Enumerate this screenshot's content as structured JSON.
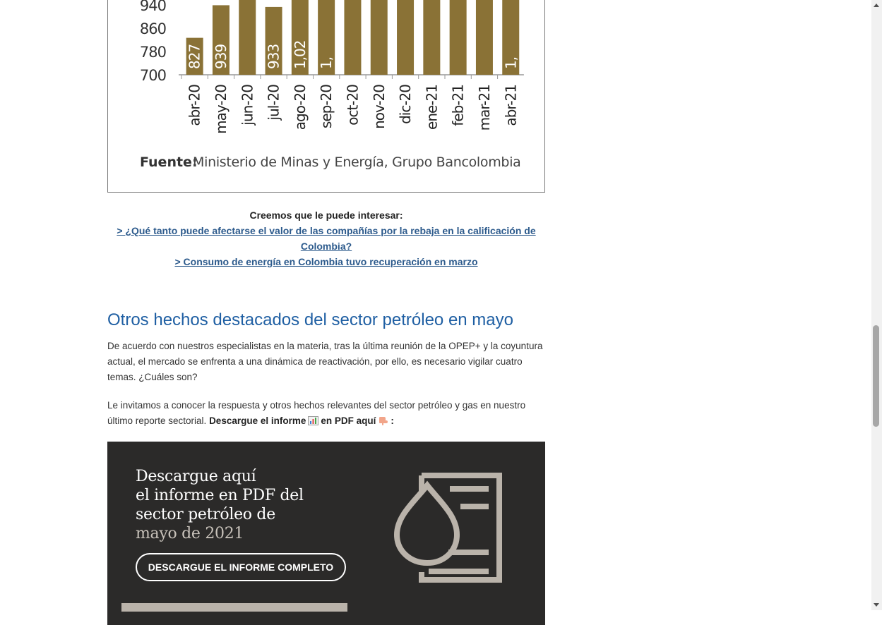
{
  "chart_data": {
    "type": "bar",
    "categories": [
      "abr-20",
      "may-20",
      "jun-20",
      "jul-20",
      "ago-20",
      "sep-20",
      "oct-20",
      "nov-20",
      "dic-20",
      "ene-21",
      "feb-21",
      "mar-21",
      "abr-21"
    ],
    "values": [
      827,
      939,
      null,
      933,
      null,
      null,
      null,
      null,
      null,
      null,
      null,
      null,
      null
    ],
    "value_labels": [
      "827",
      "939",
      "",
      "933",
      "1,02",
      "1,",
      "",
      "",
      "",
      "",
      "",
      "",
      "1,"
    ],
    "y_ticks": [
      "700",
      "780",
      "860",
      "940"
    ],
    "ylim": [
      700,
      940
    ],
    "source_label": "Fuente:",
    "source_text": "Ministerio de Minas y Energía, Grupo Bancolombia",
    "bar_color": "#8a7236"
  },
  "related": {
    "heading": "Creemos que le puede interesar:",
    "link1": "> ¿Qué tanto puede afectarse el valor de las compañías por la rebaja en la calificación de Colombia?",
    "link2": "> Consumo de energía en Colombia tuvo recuperación en marzo"
  },
  "section": {
    "title": "Otros hechos destacados del sector petróleo en mayo",
    "para1": "De acuerdo con nuestros especialistas en la materia, tras la última reunión de la OPEP+ y la coyuntura actual, el mercado se enfrenta a una dinámica de reactivación, por ello, es necesario vigilar cuatro temas. ¿Cuáles son?",
    "para2_text": "Le invitamos a conocer la respuesta y otros hechos relevantes del sector petróleo y gas en nuestro último reporte sectorial. ",
    "para2_bold_a": "Descargue el informe",
    "para2_bold_b": "en PDF aquí",
    "para2_bold_c": ":",
    "icons": [
      "bar-chart-emoji-icon",
      "pointing-down-emoji-icon"
    ]
  },
  "banner": {
    "line1": "Descargue aquí",
    "line2": "el informe en PDF del",
    "line3": "sector petróleo de",
    "line4": "mayo de 2021",
    "button": "DESCARGUE EL INFORME COMPLETO",
    "icon": "oil-drop-document-icon",
    "colors": {
      "background": "#2b2a29",
      "accent": "#bab3aa"
    }
  }
}
